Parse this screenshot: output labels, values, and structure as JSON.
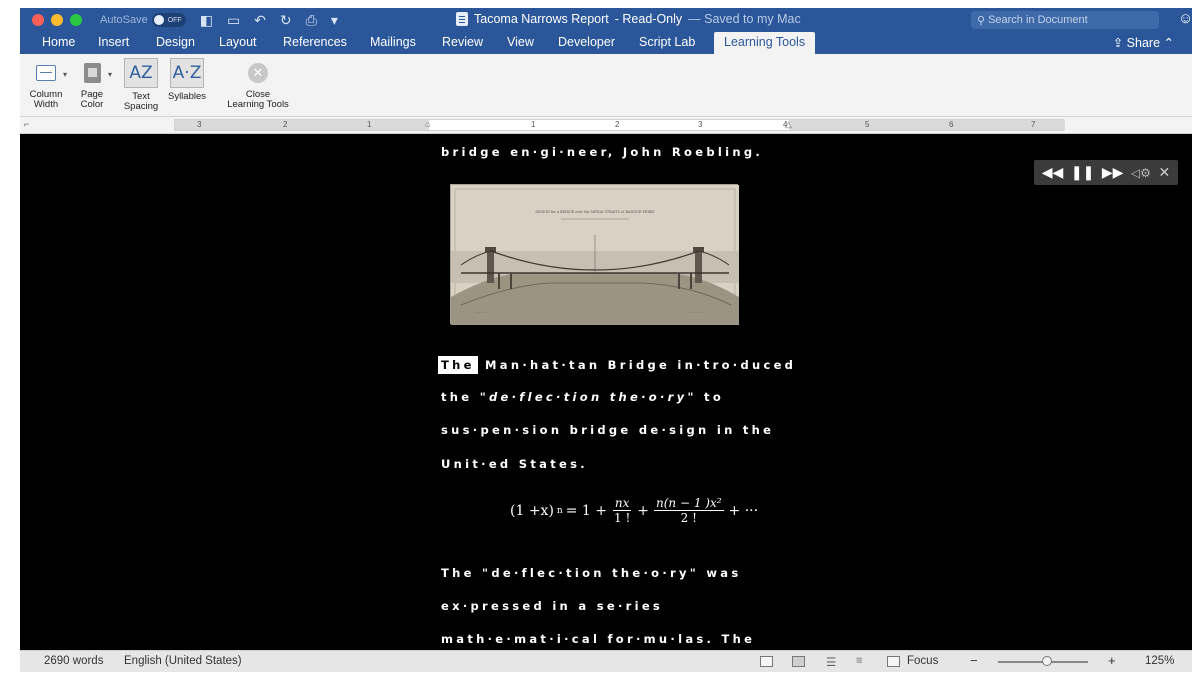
{
  "titlebar": {
    "autosave_label": "AutoSave",
    "autosave_state": "OFF",
    "doc_name": "Tacoma Narrows Report",
    "doc_status": "- Read-Only",
    "saved_note": "— Saved to my Mac",
    "search_placeholder": "Search in Document",
    "brand_color": "#2b579a"
  },
  "tabs": {
    "items": [
      "Home",
      "Insert",
      "Design",
      "Layout",
      "References",
      "Mailings",
      "Review",
      "View",
      "Developer",
      "Script Lab",
      "Learning Tools"
    ],
    "active": "Learning Tools",
    "share_label": "Share"
  },
  "ribbon": {
    "column_width_label_1": "Column",
    "column_width_label_2": "Width",
    "page_color_label_1": "Page",
    "page_color_label_2": "Color",
    "text_spacing_label_1": "Text",
    "text_spacing_label_2": "Spacing",
    "syllables_label": "Syllables",
    "close_label_1": "Close",
    "close_label_2": "Learning Tools",
    "text_spacing_glyph": "AZ",
    "syllables_glyph": "A·Z"
  },
  "ruler": {
    "numbers": [
      "3",
      "2",
      "1",
      "1",
      "2",
      "3",
      "4",
      "5",
      "6",
      "7"
    ]
  },
  "document": {
    "line_0": "bridge en·gi·neer, John Roebling.",
    "highlight_word": "The",
    "line_1_rest": "Man·hat·tan Bridge in·tro·duced",
    "line_2_a": "the \"",
    "line_2_italic": "de·flec·tion the·o·ry",
    "line_2_b": "\" to",
    "line_3": "sus·pen·sion bridge de·sign in the",
    "line_4": "Unit·ed States.",
    "formula_lhs": "(1 +x)",
    "formula_exp": "n",
    "formula_eq": "= 1 +",
    "frac1_num": "nx",
    "frac1_den": "1 !",
    "frac2_num": "n(n − 1 )x²",
    "frac2_den": "2 !",
    "formula_tail": "+ ···",
    "line_5": "The \"de·flec·tion the·o·ry\" was",
    "line_6": "ex·pressed in a se·ries",
    "line_7": "math·e·mat·i·cal for·mu·las. The",
    "figure_caption": "DESIGN for a BRIDGE over the MENAI STRAITS at BANGOR FERRY"
  },
  "readaloud": {
    "rewind": "◀◀",
    "pause": "❚❚",
    "forward": "▶▶",
    "settings": "◁⚙",
    "close": "✕"
  },
  "status": {
    "word_count": "2690 words",
    "language": "English (United States)",
    "focus_label": "Focus",
    "zoom_minus": "−",
    "zoom_plus": "+",
    "zoom_level": "125%"
  }
}
